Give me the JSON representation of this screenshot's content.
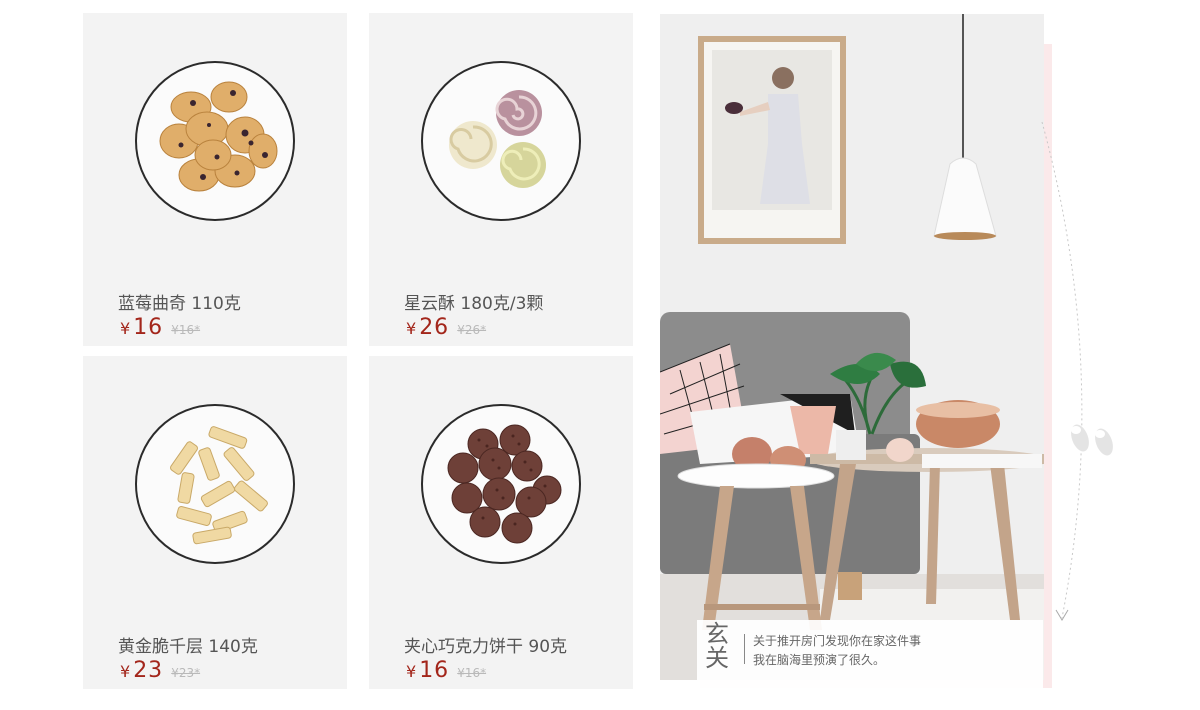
{
  "products": [
    {
      "name": "蓝莓曲奇 110克",
      "currency": "¥",
      "price": "16",
      "old_price": "¥16*"
    },
    {
      "name": "星云酥 180克/3颗",
      "currency": "¥",
      "price": "26",
      "old_price": "¥26*"
    },
    {
      "name": "黄金脆千层 140克",
      "currency": "¥",
      "price": "23",
      "old_price": "¥23*"
    },
    {
      "name": "夹心巧克力饼干 90克",
      "currency": "¥",
      "price": "16",
      "old_price": "¥16*"
    }
  ],
  "banner": {
    "title_chars": [
      "玄",
      "关"
    ],
    "caption_line1": "关于推开房门发现你在家这件事",
    "caption_line2": "我在脑海里预演了很久。"
  },
  "colors": {
    "price": "#a3261b",
    "card_bg": "#f3f3f3",
    "accent_pink": "#fbe9ea"
  },
  "icons": {
    "decor": "slippers-icon",
    "curve": "dotted-arc-arrow-icon"
  }
}
